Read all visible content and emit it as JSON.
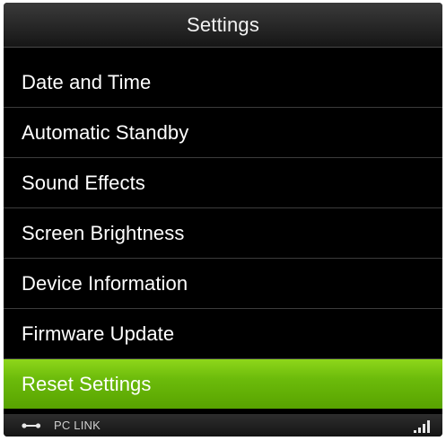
{
  "header": {
    "title": "Settings"
  },
  "menu": {
    "items": [
      {
        "label": "Date and Time"
      },
      {
        "label": "Automatic Standby"
      },
      {
        "label": "Sound Effects"
      },
      {
        "label": "Screen Brightness"
      },
      {
        "label": "Device Information"
      },
      {
        "label": "Firmware Update"
      },
      {
        "label": "Reset Settings"
      }
    ],
    "selected_index": 6
  },
  "status_bar": {
    "link_icon": "usb-link-icon",
    "link_label": "PC LINK",
    "signal_icon": "signal-strength-icon"
  },
  "colors": {
    "background": "#000000",
    "header": "#2a2a2a",
    "selected": "#6cbb0b",
    "text": "#ffffff"
  }
}
